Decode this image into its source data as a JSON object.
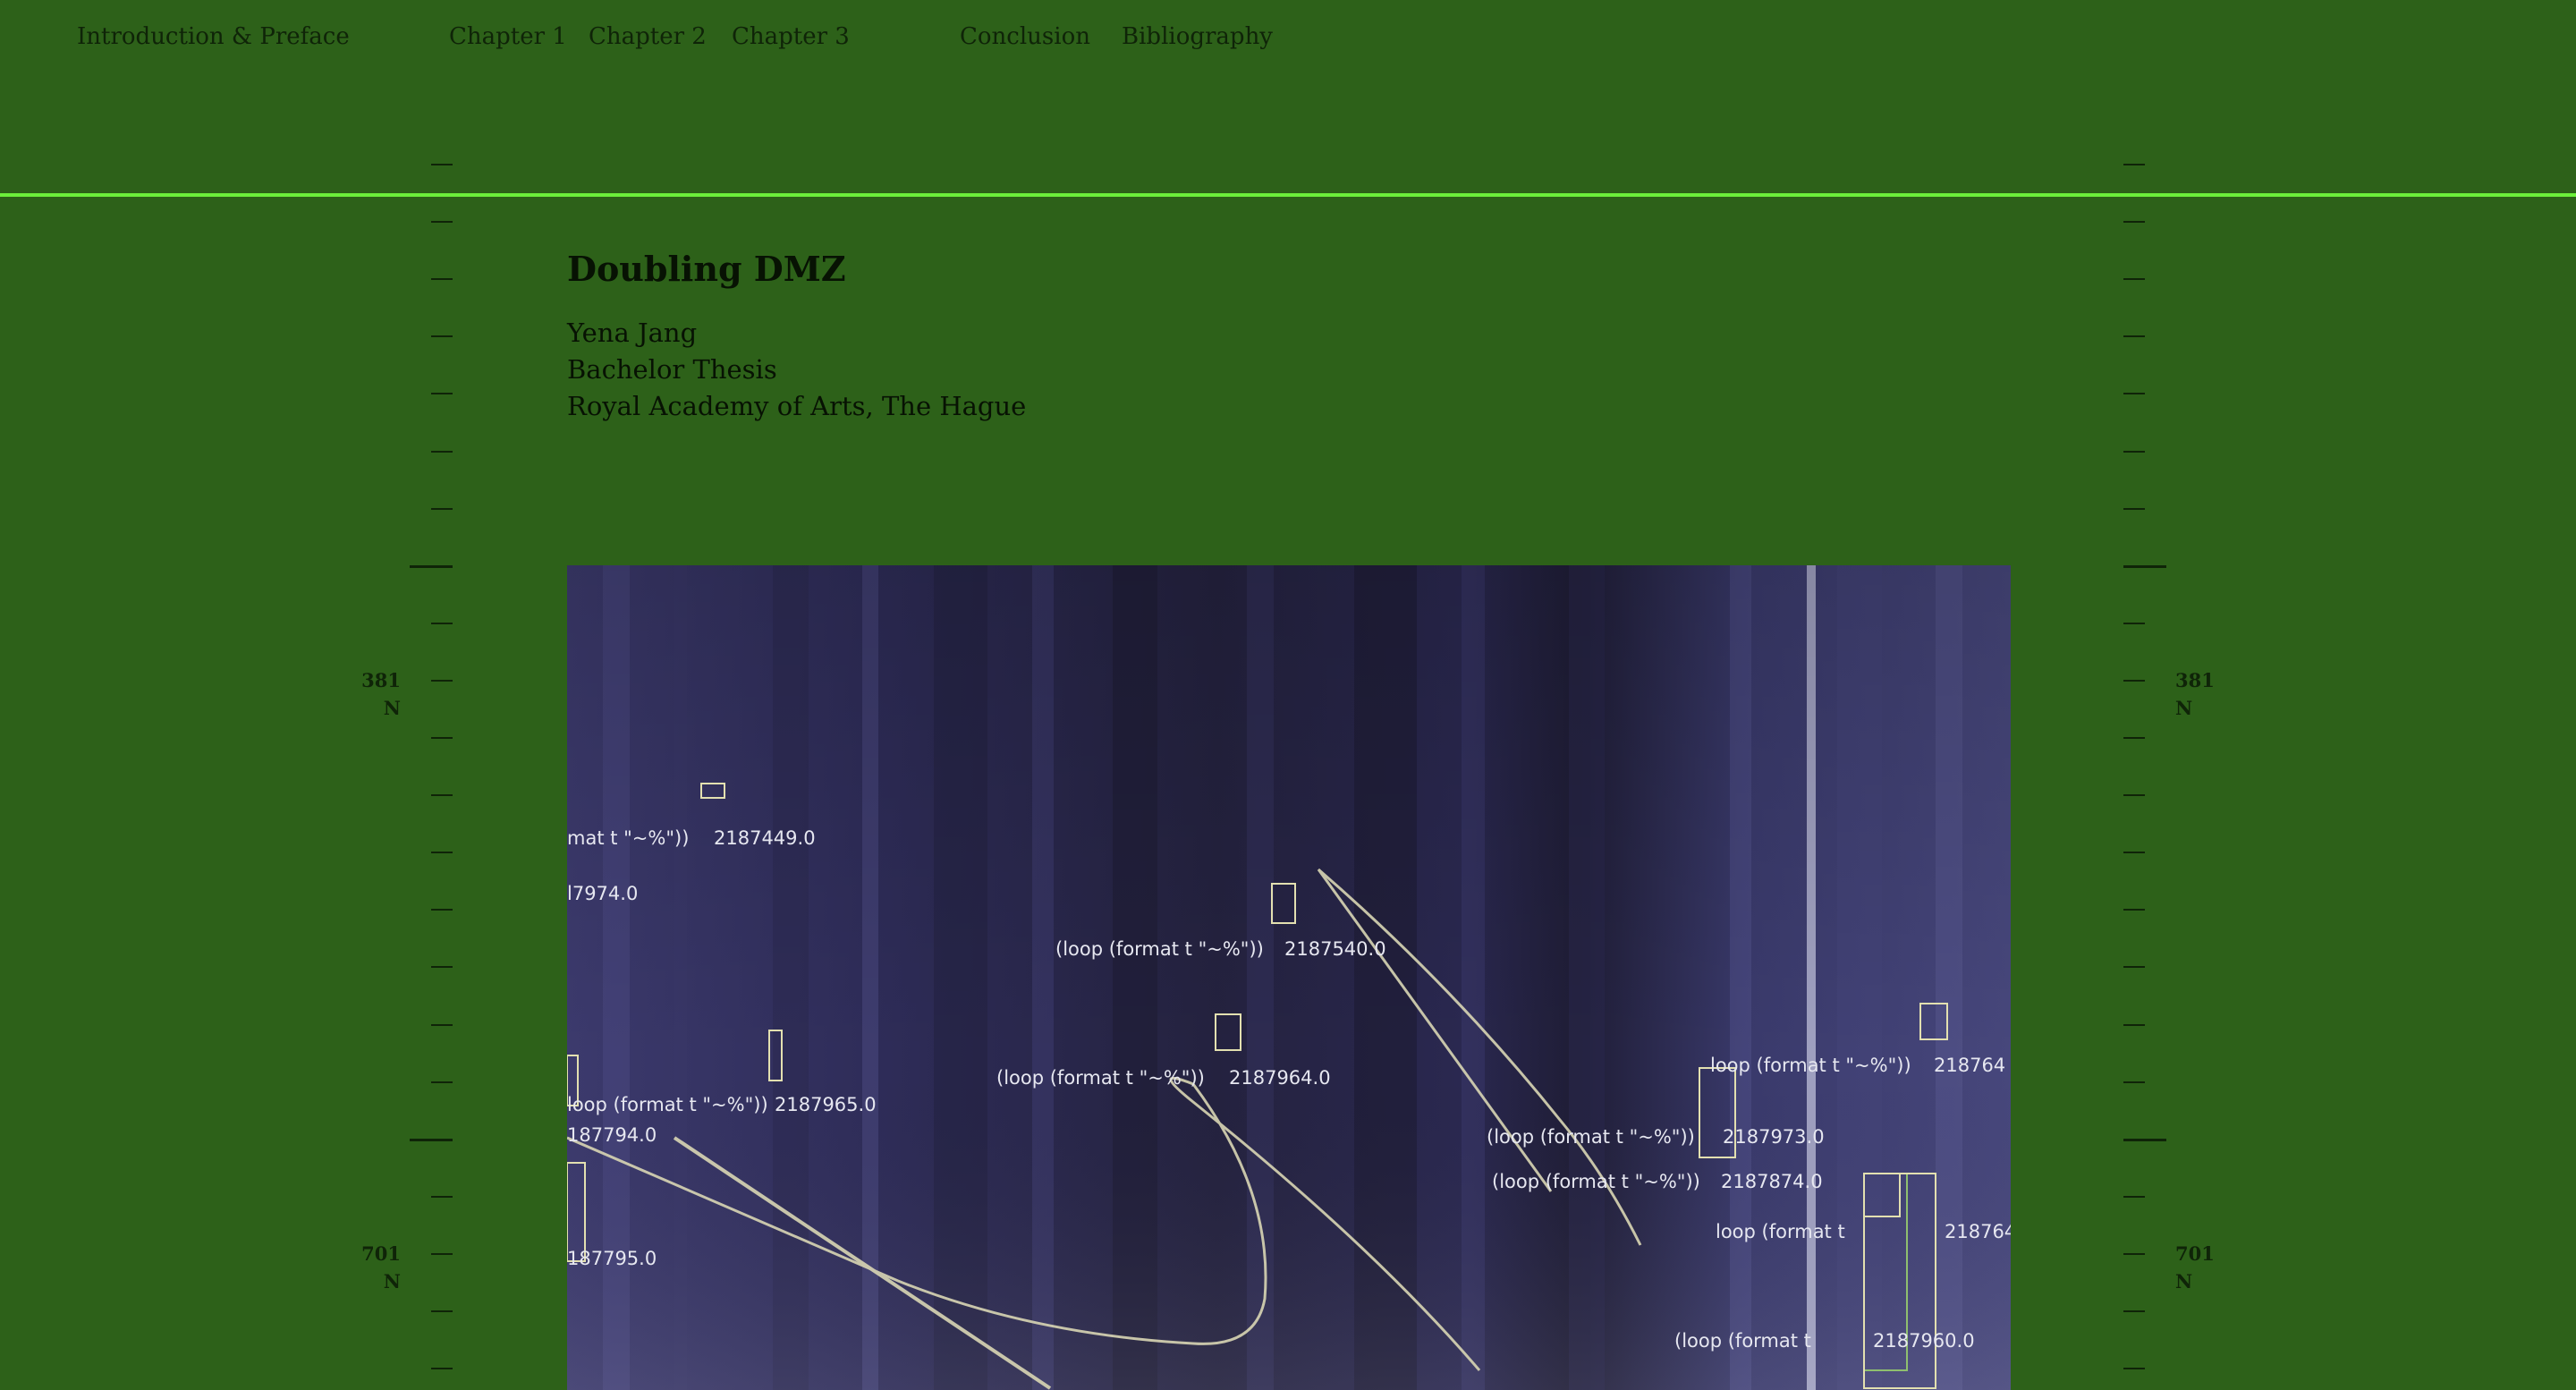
{
  "nav": {
    "items": [
      {
        "label": "Introduction & Preface"
      },
      {
        "label": "Chapter 1"
      },
      {
        "label": "Chapter 2"
      },
      {
        "label": "Chapter 3"
      },
      {
        "label": "Conclusion"
      },
      {
        "label": "Bibliography"
      }
    ]
  },
  "header": {
    "title": "Doubling DMZ",
    "author": "Yena Jang",
    "degree": "Bachelor Thesis",
    "institution": "Royal Academy of Arts, The Hague"
  },
  "ruler": {
    "marks": [
      {
        "value": "381",
        "unit": "N"
      },
      {
        "value": "701",
        "unit": "N"
      }
    ]
  },
  "figure": {
    "annotations": [
      "mat t \"~%\"))",
      "2187449.0",
      "l7974.0",
      "(loop (format t \"~%\"))",
      "2187540.0",
      "(loop (format t \"~%\"))",
      "2187964.0",
      "loop (format t \"~%\"))",
      "2187965.0",
      "187794.0",
      "187795.0",
      "loop (format t \"~%\"))",
      "218764",
      "(loop (format t \"~%\"))",
      "2187973.0",
      "(loop (format t \"~%\"))",
      "2187874.0",
      "loop (format t",
      "218764",
      "(loop (format t",
      "2187960.0"
    ]
  }
}
